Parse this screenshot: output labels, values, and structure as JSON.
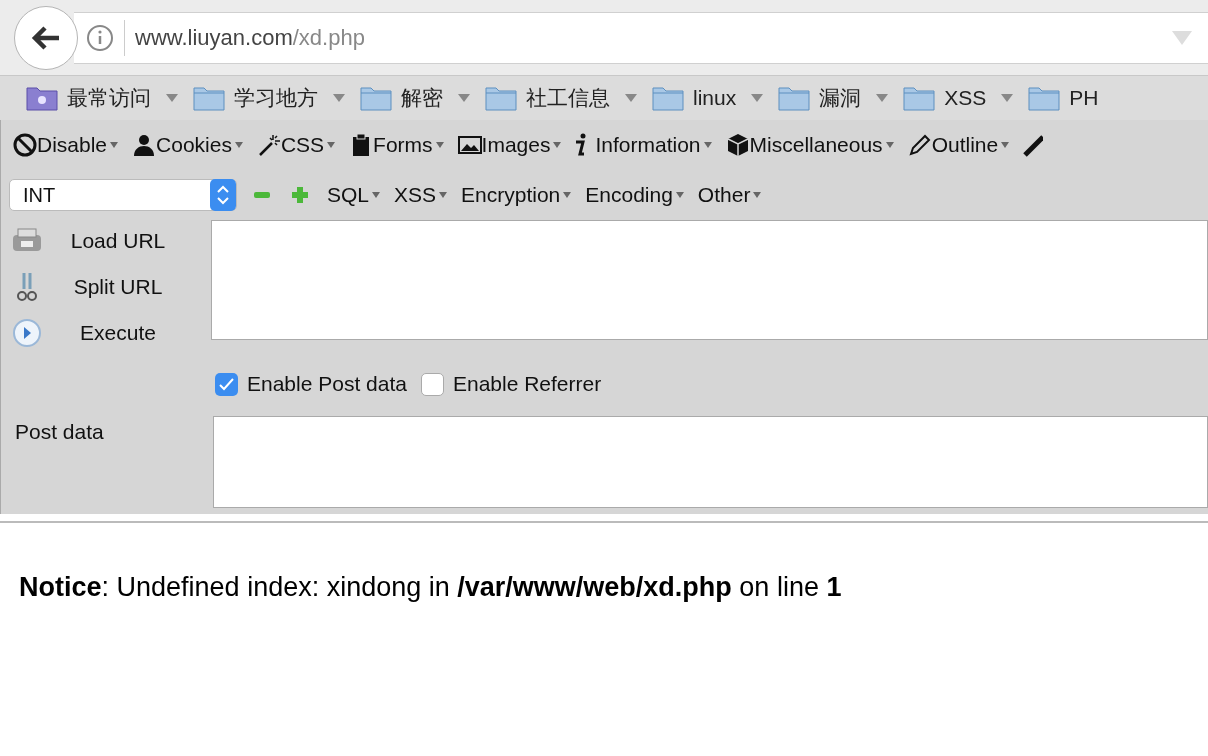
{
  "address_bar": {
    "host": "www.liuyan.com",
    "path": "/xd.php"
  },
  "bookmarks": [
    {
      "label": "最常访问",
      "kind": "smart"
    },
    {
      "label": "学习地方",
      "kind": "folder"
    },
    {
      "label": "解密",
      "kind": "folder"
    },
    {
      "label": "社工信息",
      "kind": "folder"
    },
    {
      "label": "linux",
      "kind": "folder"
    },
    {
      "label": "漏洞",
      "kind": "folder"
    },
    {
      "label": "XSS",
      "kind": "folder"
    },
    {
      "label": "PH",
      "kind": "folder"
    }
  ],
  "toolbar": [
    {
      "label": "Disable",
      "kind": "disable"
    },
    {
      "label": "Cookies",
      "kind": "user"
    },
    {
      "label": "CSS",
      "kind": "wand"
    },
    {
      "label": "Forms",
      "kind": "clipboard"
    },
    {
      "label": "Images",
      "kind": "image"
    },
    {
      "label": "Information",
      "kind": "info"
    },
    {
      "label": "Miscellaneous",
      "kind": "box"
    },
    {
      "label": "Outline",
      "kind": "pencil"
    }
  ],
  "hackbar": {
    "select": "INT",
    "menus": [
      "SQL",
      "XSS",
      "Encryption",
      "Encoding",
      "Other"
    ],
    "actions": [
      {
        "label": "Load URL",
        "kind": "load"
      },
      {
        "label": "Split URL",
        "kind": "split"
      },
      {
        "label": "Execute",
        "kind": "execute"
      }
    ],
    "options": [
      {
        "label": "Enable Post data",
        "checked": true
      },
      {
        "label": "Enable Referrer",
        "checked": false
      }
    ],
    "post_label": "Post data"
  },
  "notice": "**Notice**: Undefined index: xindong in **/var/www/web/xd.php** on line **1**"
}
